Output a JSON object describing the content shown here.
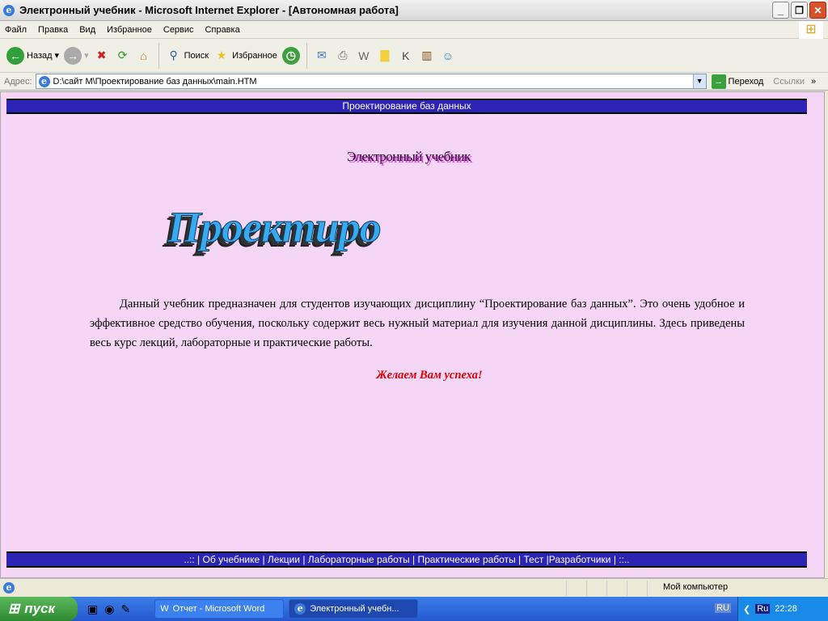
{
  "window": {
    "title": "Электронный учебник - Microsoft Internet Explorer - [Автономная работа]"
  },
  "menu": [
    "Файл",
    "Правка",
    "Вид",
    "Избранное",
    "Сервис",
    "Справка"
  ],
  "toolbar": {
    "back": "Назад",
    "search": "Поиск",
    "favorites": "Избранное"
  },
  "address": {
    "label": "Адрес:",
    "value": "D:\\сайт М\\Проектирование баз данных\\main.HTM",
    "go": "Переход",
    "links": "Ссылки"
  },
  "page": {
    "header": "Проектирование баз данных",
    "subtitle": "Электронный учебник",
    "logo": "Проектиро",
    "paragraph": "Данный учебник предназначен для студентов изучающих дисциплину “Проектирование баз данных”. Это очень удобное и эффективное средство обучения, поскольку содержит весь нужный материал для изучения данной дисциплины. Здесь приведены весь курс лекций, лабораторные и практические работы.",
    "wish": "Желаем Вам успеха!",
    "footer": {
      "pre": "..:: |",
      "links": [
        "Об учебнике",
        "Лекции",
        "Лабораторные работы",
        "Практические работы",
        "Тест",
        "Разработчики"
      ],
      "post": "| ::.."
    }
  },
  "status": {
    "zone": "Мой компьютер"
  },
  "taskbar": {
    "start": "пуск",
    "tasks": [
      "Отчет - Microsoft Word",
      "Электронный учебн..."
    ],
    "lang": "RU",
    "lang2": "Ru",
    "time": "22:28"
  }
}
